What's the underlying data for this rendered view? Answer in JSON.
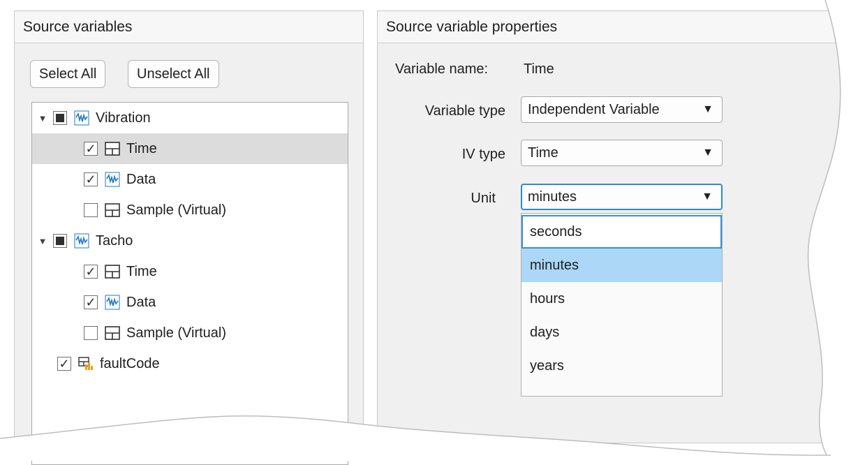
{
  "left_panel": {
    "title": "Source variables",
    "select_all_label": "Select All",
    "unselect_all_label": "Unselect All",
    "tree": [
      {
        "label": "Vibration",
        "check": "partial",
        "icon": "signal-icon",
        "expanded": true
      },
      {
        "label": "Time",
        "check": "checked",
        "icon": "table-icon",
        "selected": true
      },
      {
        "label": "Data",
        "check": "checked",
        "icon": "signal-icon"
      },
      {
        "label": "Sample (Virtual)",
        "check": "unchecked",
        "icon": "table-icon"
      },
      {
        "label": "Tacho",
        "check": "partial",
        "icon": "signal-icon",
        "expanded": true
      },
      {
        "label": "Time",
        "check": "checked",
        "icon": "table-icon"
      },
      {
        "label": "Data",
        "check": "checked",
        "icon": "signal-icon"
      },
      {
        "label": "Sample (Virtual)",
        "check": "unchecked",
        "icon": "table-icon"
      },
      {
        "label": "faultCode",
        "check": "checked",
        "icon": "scalar-icon"
      }
    ]
  },
  "right_panel": {
    "title": "Source variable properties",
    "variable_name_label": "Variable name:",
    "variable_name_value": "Time",
    "variable_type_label": "Variable type",
    "variable_type_value": "Independent Variable",
    "iv_type_label": "IV type",
    "iv_type_value": "Time",
    "unit_label": "Unit",
    "unit_value": "minutes",
    "unit_options": [
      "seconds",
      "minutes",
      "hours",
      "days",
      "years"
    ],
    "unit_focused_option": "seconds",
    "unit_highlighted_option": "minutes"
  },
  "colors": {
    "selection_highlight": "#acd7f7",
    "focus_border": "#3c8fd0",
    "signal_icon_blue": "#1f77c4",
    "scalar_icon_orange": "#e8a020"
  }
}
